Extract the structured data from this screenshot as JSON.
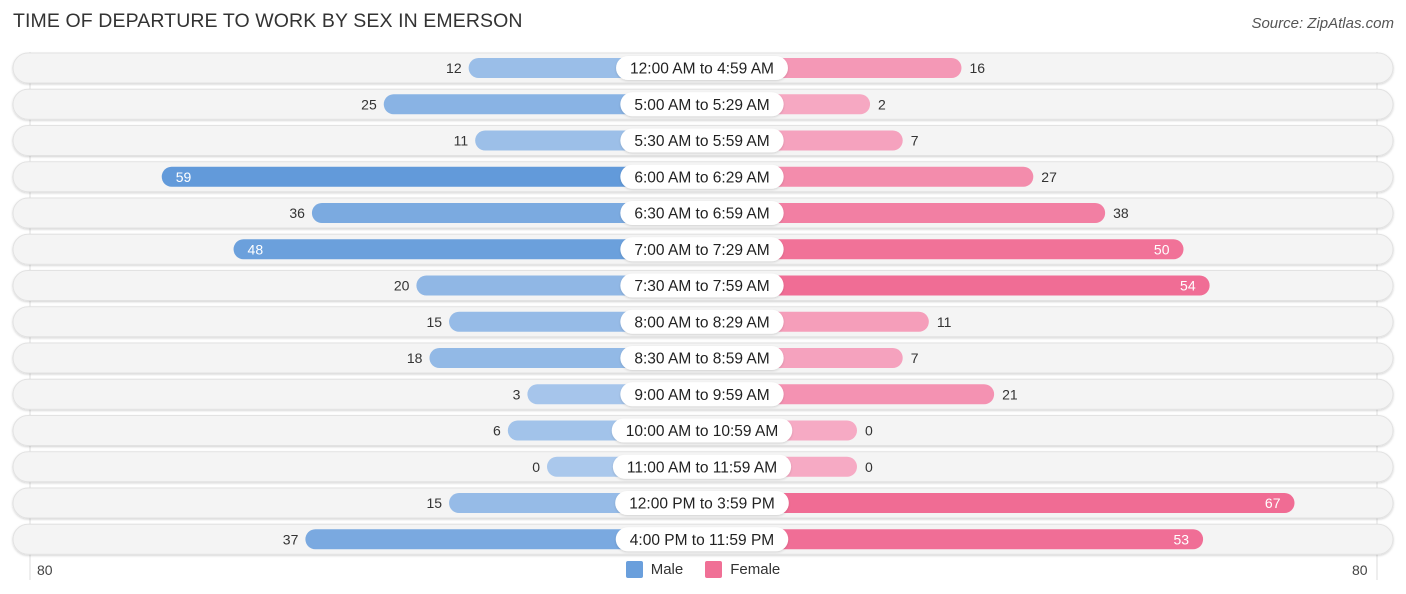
{
  "header": {
    "title": "TIME OF DEPARTURE TO WORK BY SEX IN EMERSON",
    "source": "Source: ZipAtlas.com"
  },
  "legend": {
    "male_label": "Male",
    "female_label": "Female",
    "male_color": "#6a9fdc",
    "female_color": "#f07096"
  },
  "axis": {
    "left_tick": "80",
    "right_tick": "80"
  },
  "chart_data": {
    "type": "bar",
    "orientation": "horizontal-diverging",
    "title": "TIME OF DEPARTURE TO WORK BY SEX IN EMERSON",
    "xlabel": "",
    "ylabel": "",
    "xlim": [
      -80,
      80
    ],
    "grid": false,
    "legend_position": "bottom-center",
    "categories": [
      "12:00 AM to 4:59 AM",
      "5:00 AM to 5:29 AM",
      "5:30 AM to 5:59 AM",
      "6:00 AM to 6:29 AM",
      "6:30 AM to 6:59 AM",
      "7:00 AM to 7:29 AM",
      "7:30 AM to 7:59 AM",
      "8:00 AM to 8:29 AM",
      "8:30 AM to 8:59 AM",
      "9:00 AM to 9:59 AM",
      "10:00 AM to 10:59 AM",
      "11:00 AM to 11:59 AM",
      "12:00 PM to 3:59 PM",
      "4:00 PM to 11:59 PM"
    ],
    "series": [
      {
        "name": "Male",
        "values": [
          12,
          25,
          11,
          59,
          36,
          48,
          20,
          15,
          18,
          3,
          6,
          0,
          15,
          37
        ]
      },
      {
        "name": "Female",
        "values": [
          16,
          2,
          7,
          27,
          38,
          50,
          54,
          11,
          7,
          21,
          0,
          0,
          67,
          53
        ]
      }
    ]
  }
}
